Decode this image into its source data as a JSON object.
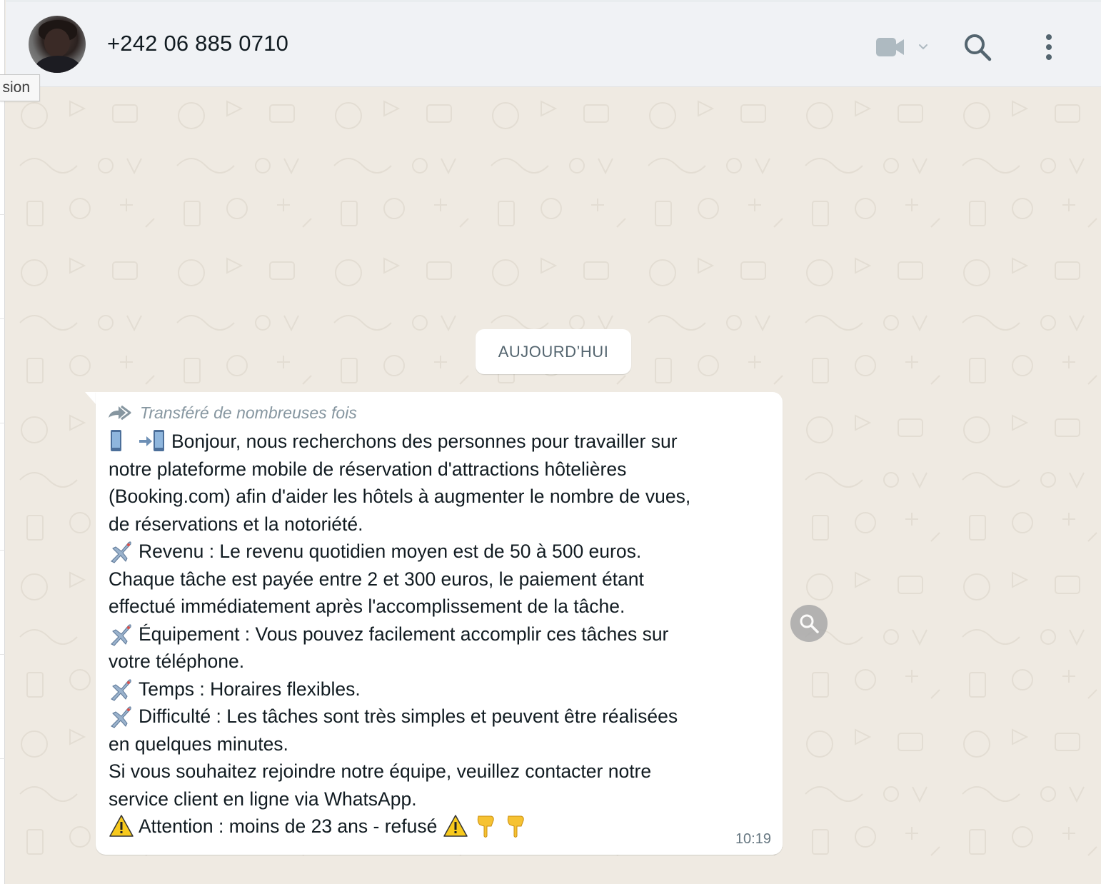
{
  "tooltip": {
    "text": "sion"
  },
  "header": {
    "contact_name": "+242 06 885 0710"
  },
  "icons": {
    "video": "video-call-icon",
    "chevron": "chevron-down-icon",
    "search": "search-icon",
    "menu": "kebab-menu-icon",
    "forward": "forwarded-many-icon",
    "zoom": "search-icon"
  },
  "date_separator": {
    "label": "AUJOURD’HUI"
  },
  "message": {
    "forwarded_label": "Transféré de nombreuses fois",
    "lines": [
      {
        "emoji": "phones",
        "text": "Bonjour, nous recherchons des personnes pour travailler sur"
      },
      {
        "emoji": "",
        "text": "notre plateforme mobile de réservation d'attractions hôtelières"
      },
      {
        "emoji": "",
        "text": "(Booking.com) afin d'aider les hôtels à augmenter le nombre de vues,"
      },
      {
        "emoji": "",
        "text": "de réservations et la notoriété."
      },
      {
        "emoji": "airplane",
        "text": "Revenu : Le revenu quotidien moyen est de 50 à 500 euros."
      },
      {
        "emoji": "",
        "text": "Chaque tâche est payée entre 2 et 300 euros, le paiement étant"
      },
      {
        "emoji": "",
        "text": "effectué immédiatement après l'accomplissement de la tâche."
      },
      {
        "emoji": "airplane",
        "text": "Équipement : Vous pouvez facilement accomplir ces tâches sur"
      },
      {
        "emoji": "",
        "text": "votre téléphone."
      },
      {
        "emoji": "airplane",
        "text": "Temps : Horaires flexibles."
      },
      {
        "emoji": "airplane",
        "text": "Difficulté : Les tâches sont très simples et peuvent être réalisées"
      },
      {
        "emoji": "",
        "text": "en quelques minutes."
      },
      {
        "emoji": "",
        "text": "Si vous souhaitez rejoindre notre équipe, veuillez contacter notre"
      },
      {
        "emoji": "",
        "text": "service client en ligne via WhatsApp."
      },
      {
        "emoji": "warning",
        "text": "Attention : moins de 23 ans - refusé",
        "trailing": "warning-point-point"
      }
    ],
    "time": "10:19"
  },
  "colors": {
    "chat_background": "#efeae2",
    "header_background": "#f0f2f5",
    "bubble": "#ffffff",
    "text_primary": "#111b21",
    "text_secondary": "#8696a0",
    "icon": "#54656f"
  }
}
